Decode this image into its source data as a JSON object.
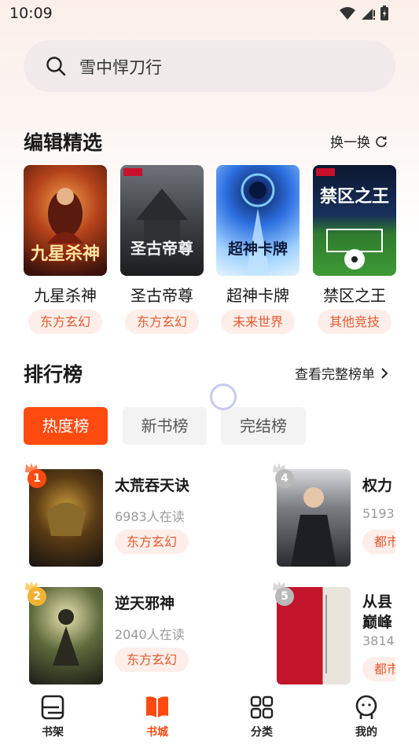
{
  "status_bar": {
    "time": "10:09"
  },
  "search": {
    "text": "雪中悍刀行"
  },
  "editor_picks": {
    "title": "编辑精选",
    "refresh_label": "换一换",
    "books": [
      {
        "name": "九星杀神",
        "tag": "东方玄幻",
        "cover_text": "九星杀神"
      },
      {
        "name": "圣古帝尊",
        "tag": "东方玄幻",
        "cover_text": "圣古帝尊"
      },
      {
        "name": "超神卡牌",
        "tag": "未来世界",
        "cover_text": "超神卡牌"
      },
      {
        "name": "禁区之王",
        "tag": "其他竞技",
        "cover_text": "禁区之王"
      }
    ]
  },
  "ranking": {
    "title": "排行榜",
    "more_label": "查看完整榜单",
    "tabs": [
      "热度榜",
      "新书榜",
      "完结榜"
    ],
    "items": [
      {
        "rank": "1",
        "title": "太荒吞天诀",
        "readers": "6983人在读",
        "tag": "东方玄幻"
      },
      {
        "rank": "2",
        "title": "逆天邪神",
        "readers": "2040人在读",
        "tag": "东方玄幻"
      },
      {
        "rank": "4",
        "title": "权力",
        "readers": "5193.",
        "tag": "都市"
      },
      {
        "rank": "5",
        "title": "从县",
        "title2": "巅峰",
        "readers": "3814.",
        "tag": "都市"
      }
    ]
  },
  "bottom_nav": [
    {
      "label": "书架",
      "icon": "bookshelf-icon"
    },
    {
      "label": "书城",
      "icon": "bookstore-icon"
    },
    {
      "label": "分类",
      "icon": "category-icon"
    },
    {
      "label": "我的",
      "icon": "profile-icon"
    }
  ],
  "colors": {
    "accent": "#ff4a10",
    "tag_bg": "#fdeee9",
    "tag_text": "#e35a30"
  }
}
